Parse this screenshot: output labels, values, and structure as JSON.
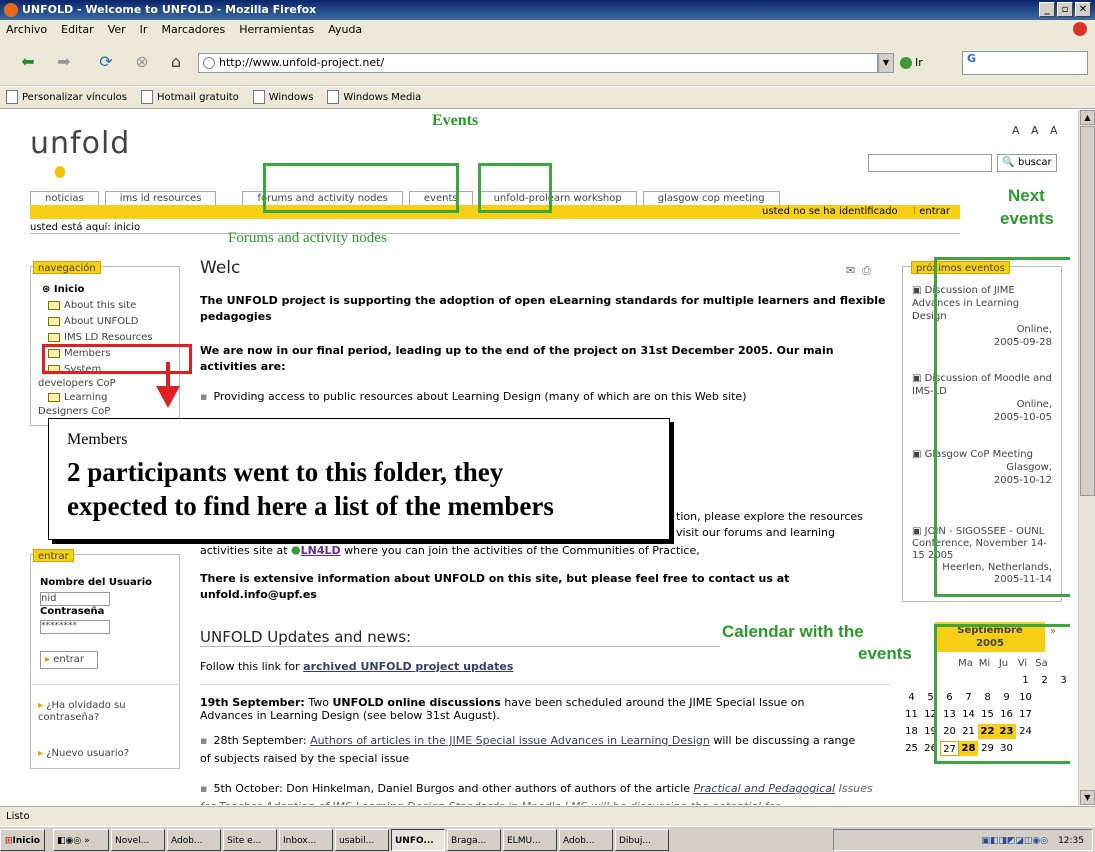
{
  "window": {
    "title": "UNFOLD - Welcome to UNFOLD - Mozilla Firefox"
  },
  "menu": [
    "Archivo",
    "Editar",
    "Ver",
    "Ir",
    "Marcadores",
    "Herramientas",
    "Ayuda"
  ],
  "url": "http://www.unfold-project.net/",
  "go_label": "Ir",
  "bookmarks": [
    "Personalizar vínculos",
    "Hotmail gratuito",
    "Windows",
    "Windows Media"
  ],
  "site": {
    "logo": "unfold",
    "fontsize": "A A A",
    "search_button": "buscar",
    "tabs": [
      "noticias",
      "ims ld resources",
      "forums and activity nodes",
      "events",
      "unfold-prolearn workshop",
      "glasgow cop meeting"
    ],
    "login_status": "usted no se ha identificado",
    "login_link": "entrar",
    "breadcrumb": "usted está aquí: inicio"
  },
  "nav": {
    "title": "navegación",
    "items": [
      "Inicio",
      "About this site",
      "About UNFOLD",
      "IMS LD Resources",
      "Members",
      "System",
      "developers CoP",
      "Learning",
      "Designers CoP"
    ]
  },
  "login": {
    "title": "entrar",
    "user_label": "Nombre del Usuario",
    "user_value": "nid",
    "pass_label": "Contraseña",
    "pass_value": "********",
    "submit": "entrar",
    "forgot": "¿Ha olvidado su contraseña?",
    "new_user": "¿Nuevo usuario?"
  },
  "main": {
    "heading": "Welc",
    "intro": "The UNFOLD project is supporting the adoption of open eLearning standards for multiple learners and flexible pedagogies",
    "final_period": "We are now in our final period, leading up to the end of the project on 31st December 2005. Our main activities are:",
    "bullet1": "Providing access to public resources about Learning Design (many of which are on this Web site)",
    "partial1": "tion, please explore the resources",
    "partial2": "visit our forums and learning",
    "activities_prefix": "activities site at",
    "ln4ld": "LN4LD",
    "activities_suffix": "where you can join the activities of the Communities of Practice,",
    "contact": "There is extensive information about UNFOLD on this site, but please feel free to contact us at",
    "email": "unfold.info@upf.es",
    "updates_heading": "UNFOLD Updates and news:",
    "follow": "Follow this link for",
    "archived": "archived UNFOLD project updates",
    "news1_date": "19th September:",
    "news1_a": "Two",
    "news1_b": "UNFOLD online discussions",
    "news1_c": "have been scheduled around the JIME Special Issue on Advances in Learning Design (see below 31st August).",
    "news2_a": "28th September:",
    "news2_link": "Authors of articles in the JIME Special issue Advances in Learning Design",
    "news2_b": "will be discussing a range of subjects raised by the special issue",
    "news3_a": "5th October: Don Hinkelman, Daniel Burgos and other authors of authors of the article",
    "news3_link": "Practical and Pedagogical",
    "news3_b": "Issues for Teacher Adoption of IMS Learning Design Standards in Moodle LMS will be discussing the potential for"
  },
  "events": {
    "title": "próximos eventos",
    "items": [
      {
        "name": "Discussion of JIME Advances in Learning Design",
        "place": "Online,",
        "date": "2005-09-28"
      },
      {
        "name": "Discussion of Moodle and IMS-LD",
        "place": "Online,",
        "date": "2005-10-05"
      },
      {
        "name": "Glasgow CoP Meeting",
        "place": "Glasgow,",
        "date": "2005-10-12"
      },
      {
        "name": "JOIN - SIGOSSEE - OUNL Conference, November 14-15 2005",
        "place": "Heerlen, Netherlands,",
        "date": "2005-11-14"
      }
    ]
  },
  "calendar": {
    "month": "Septiembre",
    "year": "2005",
    "next": "»",
    "days": [
      "Ma",
      "Mi",
      "Ju",
      "Vi",
      "Sa"
    ],
    "rows": [
      [
        "",
        "",
        "",
        "1",
        "2",
        "3"
      ],
      [
        "4",
        "5",
        "6",
        "7",
        "8",
        "9",
        "10"
      ],
      [
        "11",
        "12",
        "13",
        "14",
        "15",
        "16",
        "17"
      ],
      [
        "18",
        "19",
        "20",
        "21",
        "22",
        "23",
        "24"
      ],
      [
        "25",
        "26",
        "27",
        "28",
        "29",
        "30",
        ""
      ]
    ]
  },
  "annotations": {
    "events": "Events",
    "forums": "Forums and activity nodes",
    "next1": "Next",
    "next2": "events",
    "cal1": "Calendar with the",
    "cal2": "events",
    "callout_title": "Members",
    "callout_body1": "2 participants went to this folder, they",
    "callout_body2": "expected to find here a list of the members"
  },
  "status": "Listo",
  "taskbar": {
    "start": "Inicio",
    "items": [
      "Novel...",
      "Adob...",
      "Site e...",
      "Inbox...",
      "usabil...",
      "UNFO...",
      "Braga...",
      "ELMU...",
      "Adob...",
      "Dibuj..."
    ],
    "clock": "12:35"
  }
}
